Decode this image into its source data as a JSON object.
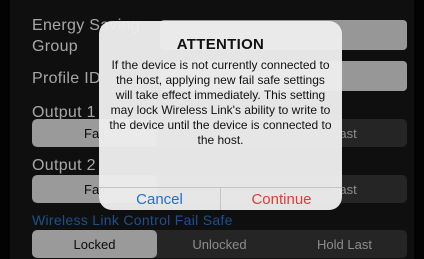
{
  "form": {
    "energy_label": "Energy Saving",
    "group_label": "Group",
    "profile_label": "Profile ID",
    "output1_label": "Output 1",
    "output2_label": "Output 2",
    "output1_options": [
      "Fail",
      "",
      "Last"
    ],
    "output2_options": [
      "Fail",
      "",
      "Last"
    ],
    "wireless_section_label": "Wireless Link Control Fail Safe",
    "wireless_options": [
      "Locked",
      "Unlocked",
      "Hold Last"
    ],
    "wireless_selected": "Locked"
  },
  "alert": {
    "title": "ATTENTION",
    "message": "If the device is not currently connected to the host, applying new fail safe settings will take effect immediately. This setting may lock Wireless Link's ability to write to the device until the device is connected to the host.",
    "cancel_label": "Cancel",
    "continue_label": "Continue"
  },
  "colors": {
    "accent_blue": "#1f6fd6",
    "destructive_red": "#e33b35",
    "section_blue": "#2a7bd8"
  }
}
